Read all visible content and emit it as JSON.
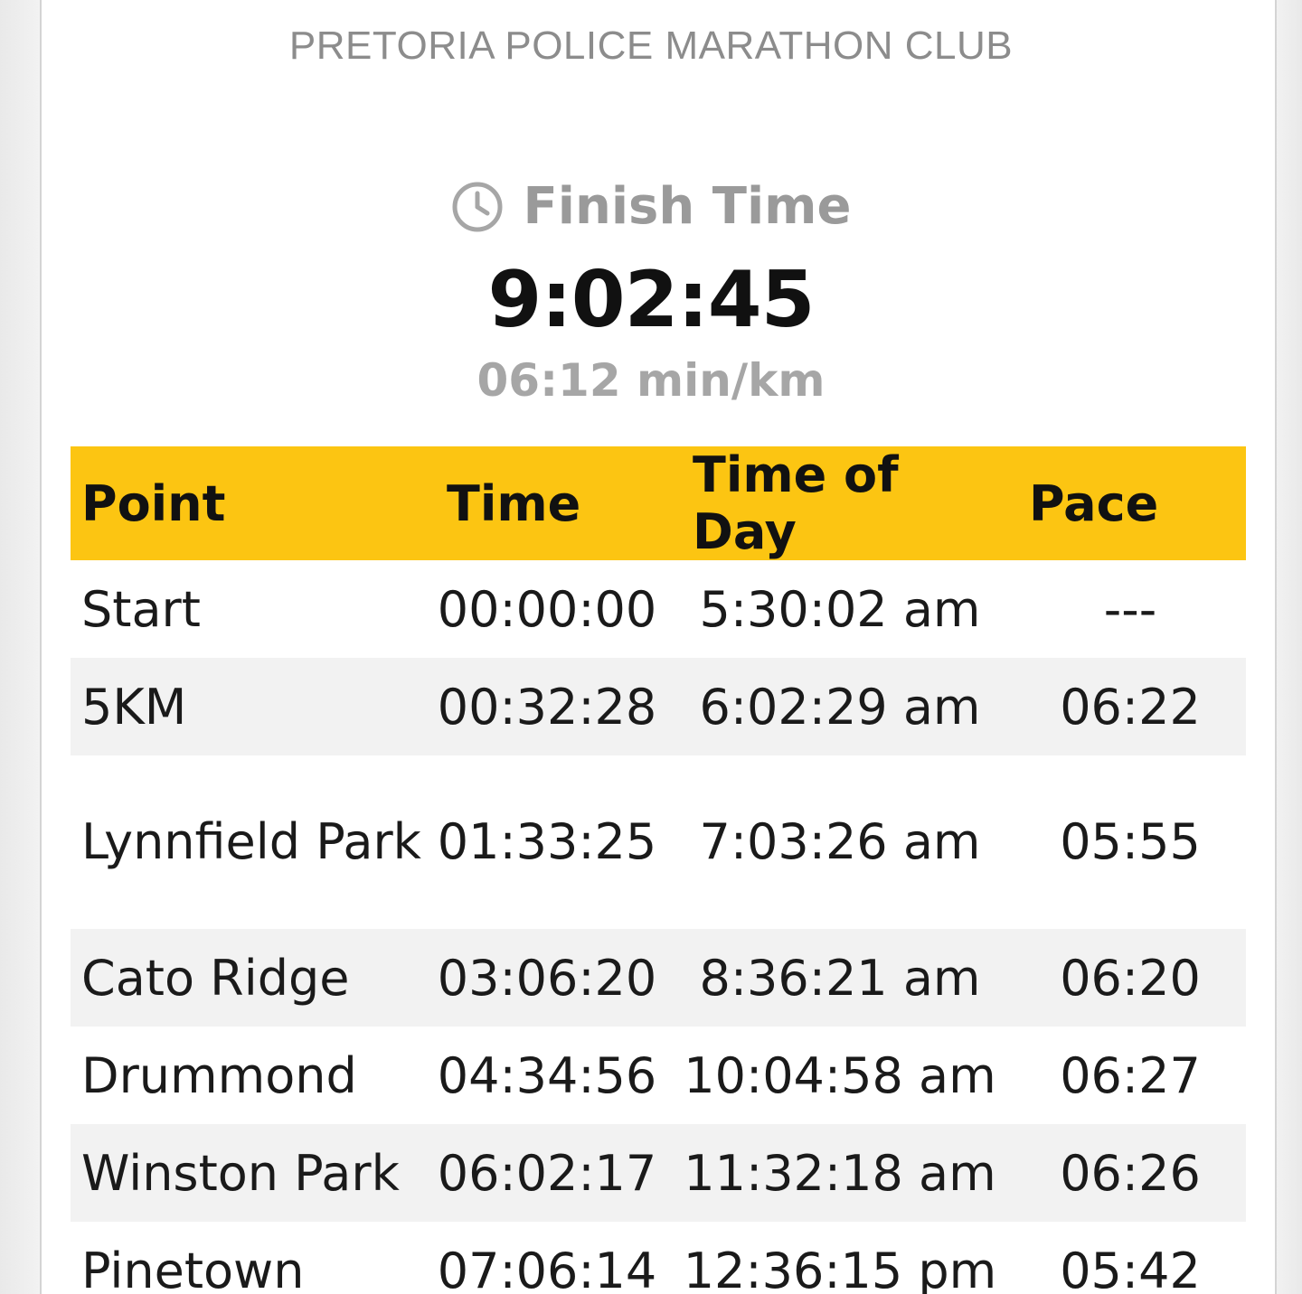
{
  "club": "PRETORIA POLICE MARATHON CLUB",
  "finish": {
    "label": "Finish Time",
    "icon": "clock-icon",
    "time": "9:02:45",
    "pace": "06:12 min/km"
  },
  "colors": {
    "header_bg": "#fcc512",
    "alt_row_bg": "#f2f2f2",
    "muted_text": "#9a9a9a"
  },
  "table": {
    "headers": {
      "point": "Point",
      "time": "Time",
      "time_of_day": "Time of Day",
      "pace": "Pace"
    },
    "rows": [
      {
        "point": "Start",
        "time": "00:00:00",
        "time_of_day": "5:30:02 am",
        "pace": "---"
      },
      {
        "point": "5KM",
        "time": "00:32:28",
        "time_of_day": "6:02:29 am",
        "pace": "06:22"
      },
      {
        "point": "Lynnfield Park",
        "time": "01:33:25",
        "time_of_day": "7:03:26 am",
        "pace": "05:55"
      },
      {
        "point": "Cato Ridge",
        "time": "03:06:20",
        "time_of_day": "8:36:21 am",
        "pace": "06:20"
      },
      {
        "point": "Drummond",
        "time": "04:34:56",
        "time_of_day": "10:04:58 am",
        "pace": "06:27"
      },
      {
        "point": "Winston Park",
        "time": "06:02:17",
        "time_of_day": "11:32:18 am",
        "pace": "06:26"
      },
      {
        "point": "Pinetown",
        "time": "07:06:14",
        "time_of_day": "12:36:15 pm",
        "pace": "05:42"
      }
    ]
  }
}
